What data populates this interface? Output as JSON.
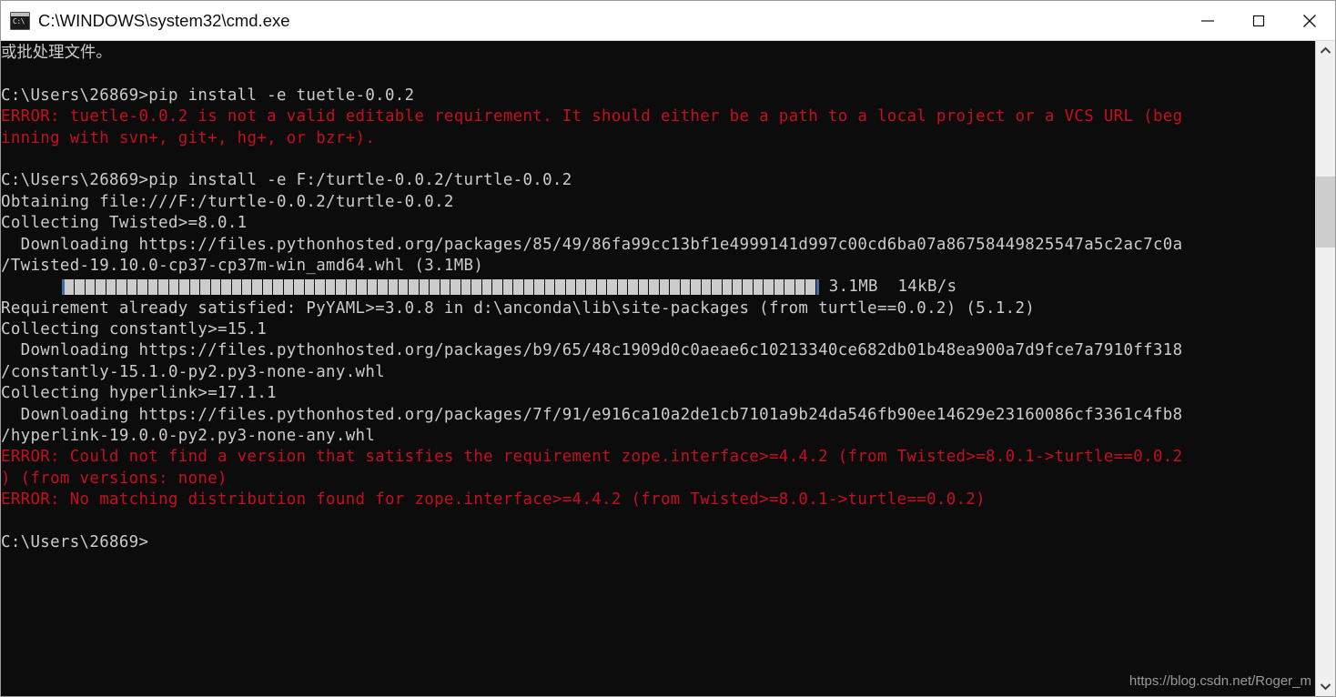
{
  "window": {
    "title": "C:\\WINDOWS\\system32\\cmd.exe",
    "icon": "cmd-icon",
    "prompt_glyph": "C:\\",
    "controls": {
      "minimize": "minimize-button",
      "maximize": "maximize-button",
      "close": "close-button"
    }
  },
  "console": {
    "background": "#0c0c0c",
    "text_color": "#cccccc",
    "error_color": "#c50f1f",
    "lines": [
      {
        "text": "或批处理文件。",
        "color": "white",
        "cjk": true
      },
      {
        "text": "",
        "color": "white"
      },
      {
        "text": "C:\\Users\\26869>pip install -e tuetle-0.0.2",
        "color": "white"
      },
      {
        "text": "ERROR: tuetle-0.0.2 is not a valid editable requirement. It should either be a path to a local project or a VCS URL (beg",
        "color": "red"
      },
      {
        "text": "inning with svn+, git+, hg+, or bzr+).",
        "color": "red"
      },
      {
        "text": "",
        "color": "white"
      },
      {
        "text": "C:\\Users\\26869>pip install -e F:/turtle-0.0.2/turtle-0.0.2",
        "color": "white"
      },
      {
        "text": "Obtaining file:///F:/turtle-0.0.2/turtle-0.0.2",
        "color": "white"
      },
      {
        "text": "Collecting Twisted>=8.0.1",
        "color": "white"
      },
      {
        "text": "  Downloading https://files.pythonhosted.org/packages/85/49/86fa99cc13bf1e4999141d997c00cd6ba07a86758449825547a5c2ac7c0a",
        "color": "white"
      },
      {
        "text": "/Twisted-19.10.0-cp37-cp37m-win_amd64.whl (3.1MB)",
        "color": "white"
      },
      {
        "text": "__PROGRESS__",
        "color": "white"
      },
      {
        "text": "Requirement already satisfied: PyYAML>=3.0.8 in d:\\anconda\\lib\\site-packages (from turtle==0.0.2) (5.1.2)",
        "color": "white"
      },
      {
        "text": "Collecting constantly>=15.1",
        "color": "white"
      },
      {
        "text": "  Downloading https://files.pythonhosted.org/packages/b9/65/48c1909d0c0aeae6c10213340ce682db01b48ea900a7d9fce7a7910ff318",
        "color": "white"
      },
      {
        "text": "/constantly-15.1.0-py2.py3-none-any.whl",
        "color": "white"
      },
      {
        "text": "Collecting hyperlink>=17.1.1",
        "color": "white"
      },
      {
        "text": "  Downloading https://files.pythonhosted.org/packages/7f/91/e916ca10a2de1cb7101a9b24da546fb90ee14629e23160086cf3361c4fb8",
        "color": "white"
      },
      {
        "text": "/hyperlink-19.0.0-py2.py3-none-any.whl",
        "color": "white"
      },
      {
        "text": "ERROR: Could not find a version that satisfies the requirement zope.interface>=4.4.2 (from Twisted>=8.0.1->turtle==0.0.2",
        "color": "red"
      },
      {
        "text": ") (from versions: none)",
        "color": "red"
      },
      {
        "text": "ERROR: No matching distribution found for zope.interface>=4.4.2 (from Twisted>=8.0.1->turtle==0.0.2)",
        "color": "red"
      },
      {
        "text": "",
        "color": "white"
      },
      {
        "text": "C:\\Users\\26869>",
        "color": "white"
      }
    ],
    "progress": {
      "cells": 72,
      "size_label": "3.1MB",
      "speed_label": "14kB/s",
      "text": "3.1MB  14kB/s"
    }
  },
  "watermark": {
    "text": "https://blog.csdn.net/Roger_m"
  },
  "scrollbar": {
    "up_arrow": "scroll-up-arrow",
    "down_arrow": "scroll-down-arrow"
  }
}
